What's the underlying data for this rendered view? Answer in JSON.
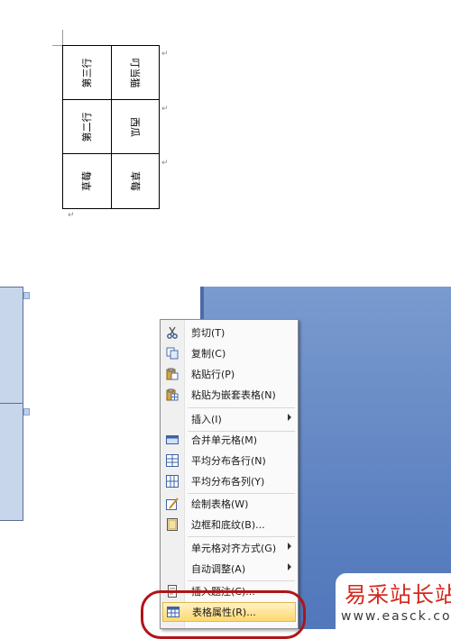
{
  "document": {
    "table": {
      "rows": [
        {
          "left": "第三行",
          "right": "叮当猫"
        },
        {
          "left": "第二行",
          "right": "西瓜"
        },
        {
          "left": "草莓",
          "right": "草莓"
        }
      ]
    }
  },
  "context_menu": {
    "items": [
      {
        "label": "剪切(T)",
        "icon": "scissors-icon"
      },
      {
        "label": "复制(C)",
        "icon": "copy-icon"
      },
      {
        "label": "粘贴行(P)",
        "icon": "paste-icon"
      },
      {
        "label": "粘贴为嵌套表格(N)",
        "icon": "paste-nested-icon"
      },
      {
        "label": "插入(I)",
        "icon": "",
        "submenu": true
      },
      {
        "label": "合并单元格(M)",
        "icon": "merge-cells-icon"
      },
      {
        "label": "平均分布各行(N)",
        "icon": "distribute-rows-icon"
      },
      {
        "label": "平均分布各列(Y)",
        "icon": "distribute-columns-icon"
      },
      {
        "label": "绘制表格(W)",
        "icon": "draw-table-icon"
      },
      {
        "label": "边框和底纹(B)...",
        "icon": "borders-icon"
      },
      {
        "label": "单元格对齐方式(G)",
        "icon": "",
        "submenu": true
      },
      {
        "label": "自动调整(A)",
        "icon": "",
        "submenu": true
      },
      {
        "label": "插入题注(C)...",
        "icon": "caption-icon"
      },
      {
        "label": "表格属性(R)...",
        "icon": "table-properties-icon",
        "highlighted": true
      }
    ]
  },
  "watermark": {
    "title": "易采站长站",
    "url": "www.easck.com"
  },
  "colors": {
    "highlight": "#ffd96f",
    "annotation_circle": "#b01418",
    "watermark_title": "#d4281c",
    "desktop_blue": "#6b8dc7"
  }
}
